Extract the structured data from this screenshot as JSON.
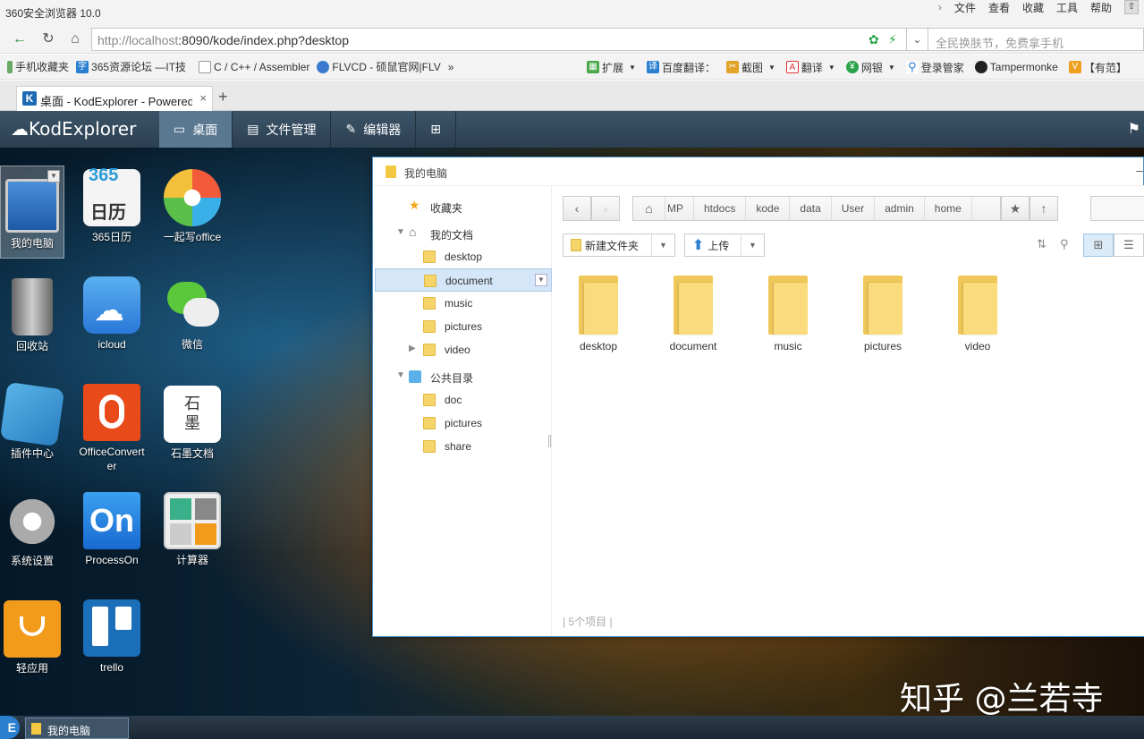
{
  "browser": {
    "app_title": "360安全浏览器 10.0",
    "menu": [
      "文件",
      "查看",
      "收藏",
      "工具",
      "帮助"
    ],
    "url_host": "http://localhost",
    "url_rest": ":8090/kode/index.php?desktop",
    "search_placeholder": "全民换肤节，免费拿手机",
    "bookmarks": [
      "手机收藏夹",
      "365资源论坛 —IT技",
      "C / C++ / Assembler",
      "FLVCD - 硕鼠官网|FLV"
    ],
    "bookmark_more": "»",
    "extensions": [
      "扩展",
      "百度翻译：",
      "截图",
      "翻译",
      "网银",
      "登录管家",
      "Tampermonke",
      "【有范】"
    ],
    "tab_title": "桌面 - KodExplorer - Powered",
    "tab_icon": "K",
    "tab_close": "×",
    "new_tab": "+"
  },
  "kod": {
    "logo": "KodExplorer",
    "nav": [
      {
        "label": "桌面",
        "icon": "monitor-icon"
      },
      {
        "label": "文件管理",
        "icon": "file-manager-icon"
      },
      {
        "label": "编辑器",
        "icon": "edit-icon"
      },
      {
        "label": "",
        "icon": "grid-icon"
      }
    ]
  },
  "desktop": {
    "icons": [
      {
        "label": "我的电脑"
      },
      {
        "label": "365日历"
      },
      {
        "label": "一起写office"
      },
      {
        "label": "回收站"
      },
      {
        "label": "icloud"
      },
      {
        "label": "微信"
      },
      {
        "label": "插件中心"
      },
      {
        "label": "OfficeConvert"
      },
      {
        "label": "er"
      },
      {
        "label": "石墨文档"
      },
      {
        "label": "系统设置"
      },
      {
        "label": "ProcessOn"
      },
      {
        "label": "计算器"
      },
      {
        "label": "轻应用"
      },
      {
        "label": "trello"
      }
    ],
    "calendar_top": "365",
    "calendar_text": "日历",
    "shimo_text": "石\n墨",
    "processon_text": "On"
  },
  "explorer": {
    "title": "我的电脑",
    "tree": [
      {
        "label": "收藏夹"
      },
      {
        "label": "我的文档"
      },
      {
        "label": "desktop"
      },
      {
        "label": "document"
      },
      {
        "label": "music"
      },
      {
        "label": "pictures"
      },
      {
        "label": "video"
      },
      {
        "label": "公共目录"
      },
      {
        "label": "doc"
      },
      {
        "label": "pictures"
      },
      {
        "label": "share"
      }
    ],
    "breadcrumbs": [
      "MP",
      "htdocs",
      "kode",
      "data",
      "User",
      "admin",
      "home"
    ],
    "new_folder": "新建文件夹",
    "upload": "上传",
    "files": [
      "desktop",
      "document",
      "music",
      "pictures",
      "video"
    ],
    "status": "5个项目"
  },
  "taskbar": {
    "start": "E",
    "task_label": "我的电脑"
  },
  "watermark": "知乎 @兰若寺",
  "colors": {
    "kod_bar": "#2b3f51",
    "folder": "#fbdc7d",
    "selection": "#d4e6f7"
  }
}
